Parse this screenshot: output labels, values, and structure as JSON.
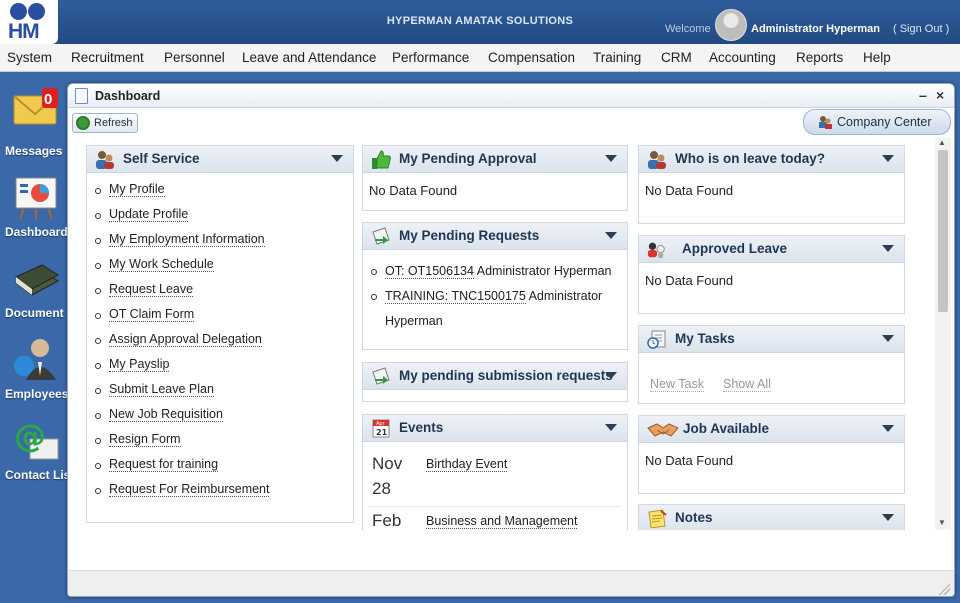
{
  "header": {
    "logo_text": "HM",
    "company_name": "HYPERMAN AMATAK SOLUTIONS",
    "welcome": "Welcome",
    "user_name": "Administrator Hyperman",
    "signout": "( Sign Out )"
  },
  "menu": [
    "System",
    "Recruitment",
    "Personnel",
    "Leave and Attendance",
    "Performance",
    "Compensation",
    "Training",
    "CRM",
    "Accounting",
    "Reports",
    "Help"
  ],
  "desktop": {
    "messages_label": "Messages",
    "messages_badge": "0",
    "dashboard_label": "Dashboard",
    "document_label": "Document Library",
    "employees_label": "Employees",
    "contact_label": "Contact List"
  },
  "window": {
    "title": "Dashboard",
    "minimize": "–",
    "close": "×",
    "refresh": "Refresh",
    "company_center": "Company Center"
  },
  "self_service": {
    "title": "Self Service",
    "items": [
      "My Profile",
      "Update Profile",
      "My Employment Information",
      "My Work Schedule",
      "Request Leave",
      "OT Claim Form",
      "Assign Approval Delegation",
      "My Payslip",
      "Submit Leave Plan",
      "New Job Requisition",
      "Resign Form",
      "Request for training",
      "Request For Reimbursement"
    ]
  },
  "pending_approval": {
    "title": "My Pending Approval",
    "empty": "No Data Found"
  },
  "pending_requests": {
    "title": "My Pending Requests",
    "items": [
      {
        "link": "OT: OT1506134",
        "rest": " Administrator Hyperman"
      },
      {
        "link": "TRAINING: TNC1500175",
        "rest": " Administrator Hyperman"
      }
    ]
  },
  "pending_submission": {
    "title": "My pending submission requests"
  },
  "events": {
    "title": "Events",
    "icon_month": "Apr",
    "icon_day": "21",
    "items": [
      {
        "month": "Nov",
        "day": "28",
        "name": "Birthday Event"
      },
      {
        "month": "Feb",
        "day": "",
        "name": "Business and Management"
      }
    ]
  },
  "on_leave_today": {
    "title": "Who is on leave today?",
    "empty": "No Data Found"
  },
  "approved_leave": {
    "title": "Approved Leave",
    "empty": "No Data Found"
  },
  "my_tasks": {
    "title": "My Tasks",
    "new_task": "New Task",
    "show_all": "Show All"
  },
  "job_available": {
    "title": "Job Available",
    "empty": "No Data Found"
  },
  "notes": {
    "title": "Notes"
  }
}
